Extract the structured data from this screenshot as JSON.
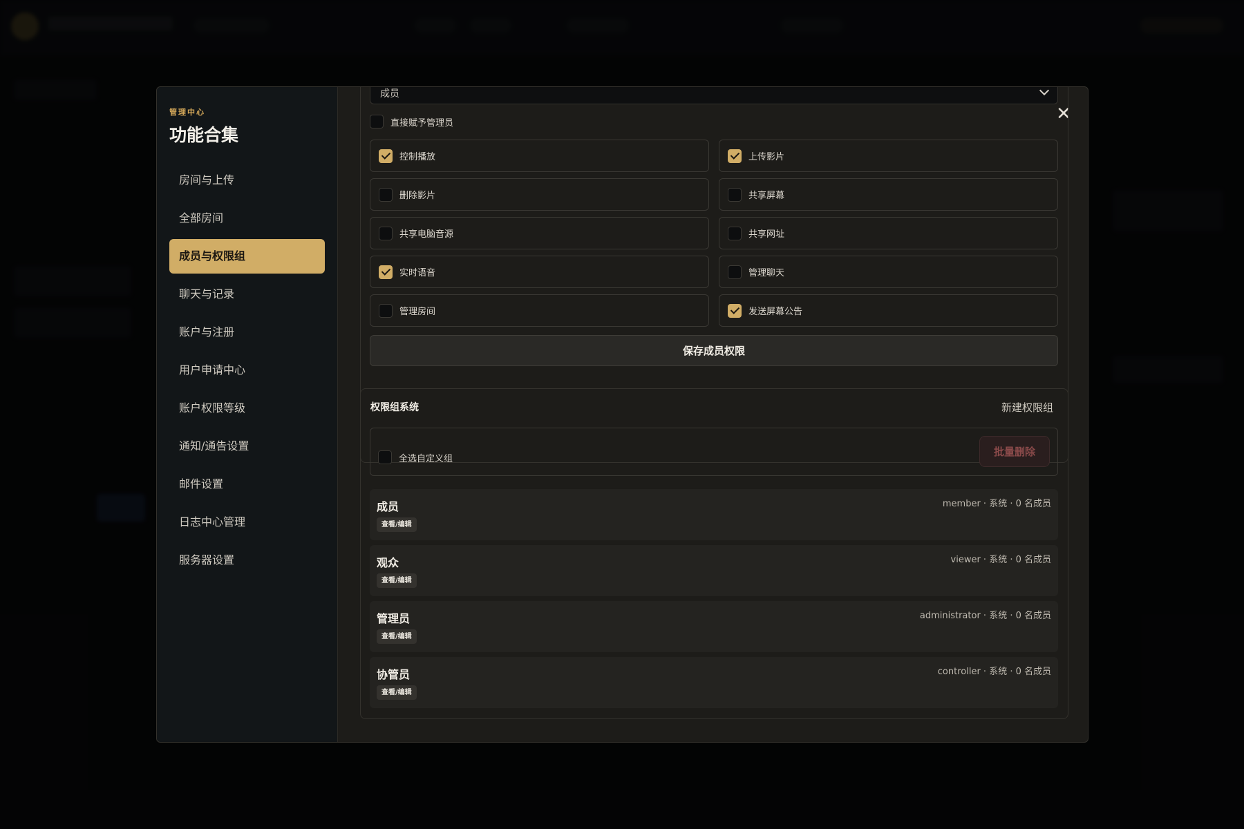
{
  "modal": {
    "eyebrow": "管理中心",
    "title": "功能合集",
    "nav": [
      {
        "label": "房间与上传",
        "active": false
      },
      {
        "label": "全部房间",
        "active": false
      },
      {
        "label": "成员与权限组",
        "active": true
      },
      {
        "label": "聊天与记录",
        "active": false
      },
      {
        "label": "账户与注册",
        "active": false
      },
      {
        "label": "用户申请中心",
        "active": false
      },
      {
        "label": "账户权限等级",
        "active": false
      },
      {
        "label": "通知/通告设置",
        "active": false
      },
      {
        "label": "邮件设置",
        "active": false
      },
      {
        "label": "日志中心管理",
        "active": false
      },
      {
        "label": "服务器设置",
        "active": false
      }
    ],
    "close_icon": "close-icon"
  },
  "permissions": {
    "role_select_value": "成员",
    "direct_admin_label": "直接赋予管理员",
    "direct_admin_checked": false,
    "items": [
      {
        "label": "控制播放",
        "checked": true
      },
      {
        "label": "上传影片",
        "checked": true
      },
      {
        "label": "删除影片",
        "checked": false
      },
      {
        "label": "共享屏幕",
        "checked": false
      },
      {
        "label": "共享电脑音源",
        "checked": false
      },
      {
        "label": "共享网址",
        "checked": false
      },
      {
        "label": "实时语音",
        "checked": true
      },
      {
        "label": "管理聊天",
        "checked": false
      },
      {
        "label": "管理房间",
        "checked": false
      },
      {
        "label": "发送屏幕公告",
        "checked": true
      }
    ],
    "save_label": "保存成员权限"
  },
  "groups": {
    "title": "权限组系统",
    "new_label": "新建权限组",
    "select_all_label": "全选自定义组",
    "batch_delete_label": "批量删除",
    "list": [
      {
        "name": "成员",
        "meta": "member · 系统 · 0 名成员",
        "button": "查看/编辑"
      },
      {
        "name": "观众",
        "meta": "viewer · 系统 · 0 名成员",
        "button": "查看/编辑"
      },
      {
        "name": "管理员",
        "meta": "administrator · 系统 · 0 名成员",
        "button": "查看/编辑"
      },
      {
        "name": "协管员",
        "meta": "controller · 系统 · 0 名成员",
        "button": "查看/编辑"
      }
    ]
  },
  "colors": {
    "accent": "#d1ad66",
    "danger_text": "#8a4a4a",
    "modal_bg": "#1d1c19",
    "sidebar_bg": "#121618"
  }
}
